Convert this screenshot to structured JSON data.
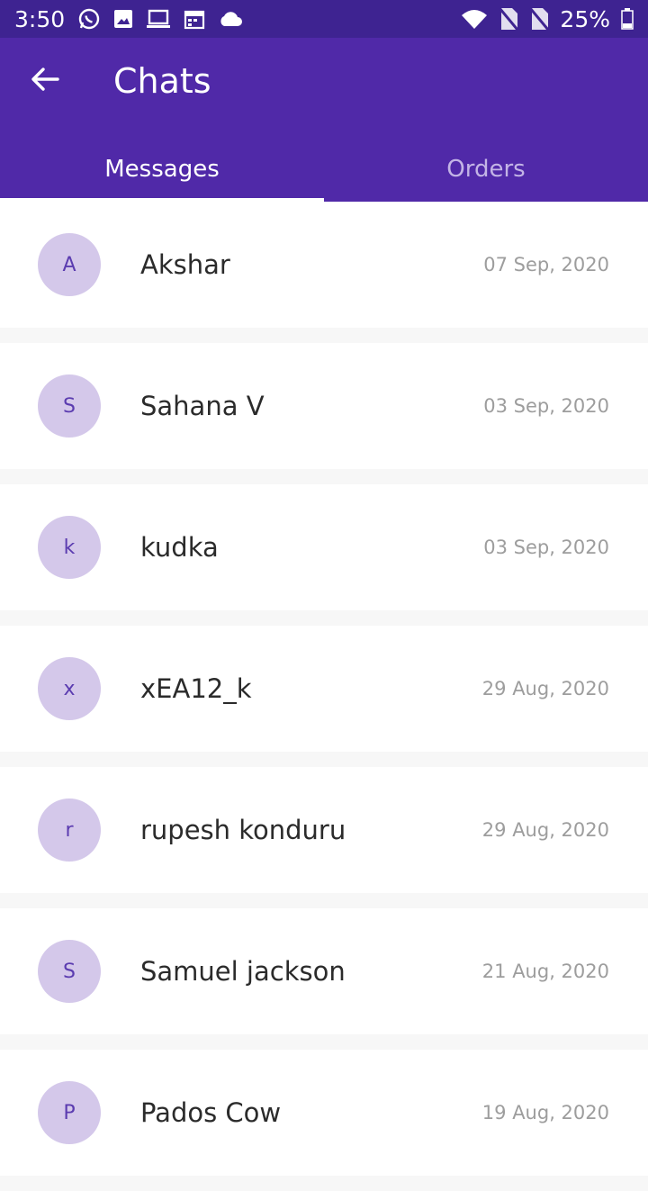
{
  "status_bar": {
    "time": "3:50",
    "battery": "25%",
    "icons_left": [
      "whatsapp-icon",
      "image-icon",
      "laptop-icon",
      "calendar-icon",
      "cloud-icon"
    ],
    "icons_right": [
      "wifi-icon",
      "no-sim-icon",
      "no-sim-icon",
      "battery-icon"
    ]
  },
  "app_bar": {
    "title": "Chats",
    "back_icon": "arrow-back-icon",
    "background": "#5029a8"
  },
  "tabs": [
    {
      "label": "Messages",
      "active": true
    },
    {
      "label": "Orders",
      "active": false
    }
  ],
  "chats": [
    {
      "initial": "A",
      "name": "Akshar",
      "date": "07 Sep, 2020"
    },
    {
      "initial": "S",
      "name": "Sahana V",
      "date": "03 Sep, 2020"
    },
    {
      "initial": "k",
      "name": "kudka",
      "date": "03 Sep, 2020"
    },
    {
      "initial": "x",
      "name": "xEA12_k",
      "date": "29 Aug, 2020"
    },
    {
      "initial": "r",
      "name": "rupesh konduru",
      "date": "29 Aug, 2020"
    },
    {
      "initial": "S",
      "name": "Samuel jackson",
      "date": "21 Aug, 2020"
    },
    {
      "initial": "P",
      "name": "Pados Cow",
      "date": "19 Aug, 2020"
    }
  ]
}
